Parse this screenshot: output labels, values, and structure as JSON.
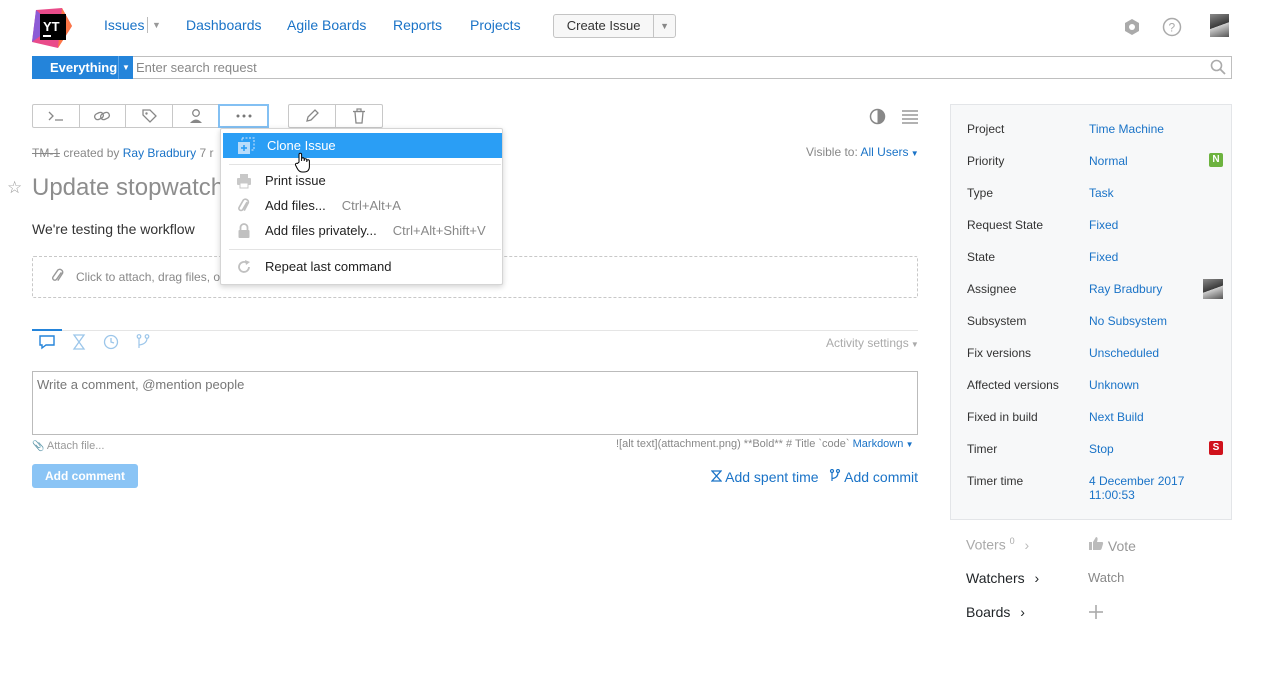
{
  "header": {
    "logo_text": "YT",
    "nav": {
      "issues": "Issues",
      "dashboards": "Dashboards",
      "agile_boards": "Agile Boards",
      "reports": "Reports",
      "projects": "Projects"
    },
    "create_issue": "Create Issue"
  },
  "search": {
    "context": "Everything",
    "placeholder": "Enter search request"
  },
  "issue": {
    "id": "TM-1",
    "created_by_prefix": "created by",
    "author": "Ray Bradbury",
    "created_suffix": "7 r",
    "visible_to_label": "Visible to:",
    "visible_to_value": "All Users",
    "summary": "Update stopwatch",
    "description": "We're testing the workflow",
    "attach_hint": "Click to attach, drag files, o"
  },
  "menu": {
    "items": [
      {
        "label": "Clone Issue",
        "shortcut": "",
        "icon": "clone-icon"
      },
      {
        "label": "Print issue",
        "shortcut": "",
        "icon": "printer-icon"
      },
      {
        "label": "Add files...",
        "shortcut": "Ctrl+Alt+A",
        "icon": "paperclip-icon"
      },
      {
        "label": "Add files privately...",
        "shortcut": "Ctrl+Alt+Shift+V",
        "icon": "lock-icon"
      },
      {
        "label": "Repeat last command",
        "shortcut": "",
        "icon": "repeat-icon"
      }
    ]
  },
  "activity": {
    "settings": "Activity settings",
    "comment_placeholder": "Write a comment, @mention people",
    "attach_file": "Attach file...",
    "markdown_hint": "![alt text](attachment.png) **Bold** # Title `code`",
    "markdown_link": "Markdown",
    "add_comment": "Add comment",
    "add_spent_time": "Add spent time",
    "add_commit": "Add commit"
  },
  "fields": [
    {
      "label": "Project",
      "value": "Time Machine"
    },
    {
      "label": "Priority",
      "value": "Normal",
      "badge": "N",
      "badge_color": "#6db33f"
    },
    {
      "label": "Type",
      "value": "Task"
    },
    {
      "label": "Request State",
      "value": "Fixed"
    },
    {
      "label": "State",
      "value": "Fixed"
    },
    {
      "label": "Assignee",
      "value": "Ray Bradbury"
    },
    {
      "label": "Subsystem",
      "value": "No Subsystem"
    },
    {
      "label": "Fix versions",
      "value": "Unscheduled"
    },
    {
      "label": "Affected versions",
      "value": "Unknown"
    },
    {
      "label": "Fixed in build",
      "value": "Next Build"
    },
    {
      "label": "Timer",
      "value": "Stop",
      "badge": "S",
      "badge_color": "#d0121c"
    },
    {
      "label": "Timer time",
      "value": "4 December 2017",
      "value2": "11:00:53"
    }
  ],
  "side": {
    "voters": "Voters",
    "voters_count": "0",
    "vote": "Vote",
    "watchers": "Watchers",
    "watch": "Watch",
    "boards": "Boards"
  },
  "colors": {
    "accent": "#2484da",
    "link": "#1a73c7",
    "highlight": "#2a9ef5"
  }
}
